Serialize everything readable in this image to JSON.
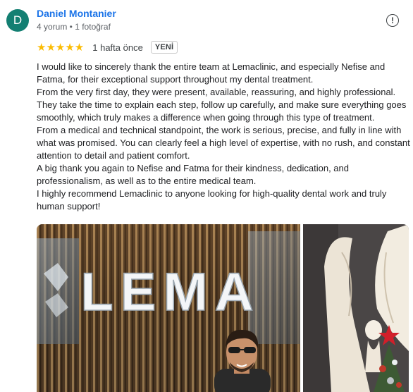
{
  "reviewer": {
    "initial": "D",
    "name": "Daniel Montanier",
    "meta": "4 yorum • 1 fotoğraf",
    "avatar_color": "#137f72"
  },
  "rating": {
    "stars": "★★★★★",
    "time_ago": "1 hafta önce",
    "badge": "YENİ",
    "star_color": "#fbbc04"
  },
  "report_icon": "!",
  "review_paragraphs": [
    "I would like to sincerely thank the entire team at Lemaclinic, and especially Nefise and Fatma, for their exceptional support throughout my dental treatment.",
    "From the very first day, they were present, available, reassuring, and highly professional. They take the time to explain each step, follow up carefully, and make sure everything goes smoothly, which truly makes a difference when going through this type of treatment.",
    "From a medical and technical standpoint, the work is serious, precise, and fully in line with what was promised. You can clearly feel a high level of expertise, with no rush, and constant attention to detail and patient comfort.",
    "A big thank you again to Nefise and Fatma for their kindness, dedication, and professionalism, as well as to the entire medical team.",
    "I highly recommend Lemaclinic to anyone looking for high-quality dental work and truly human support!"
  ],
  "photos": {
    "photo1_sign": "LEMA"
  }
}
